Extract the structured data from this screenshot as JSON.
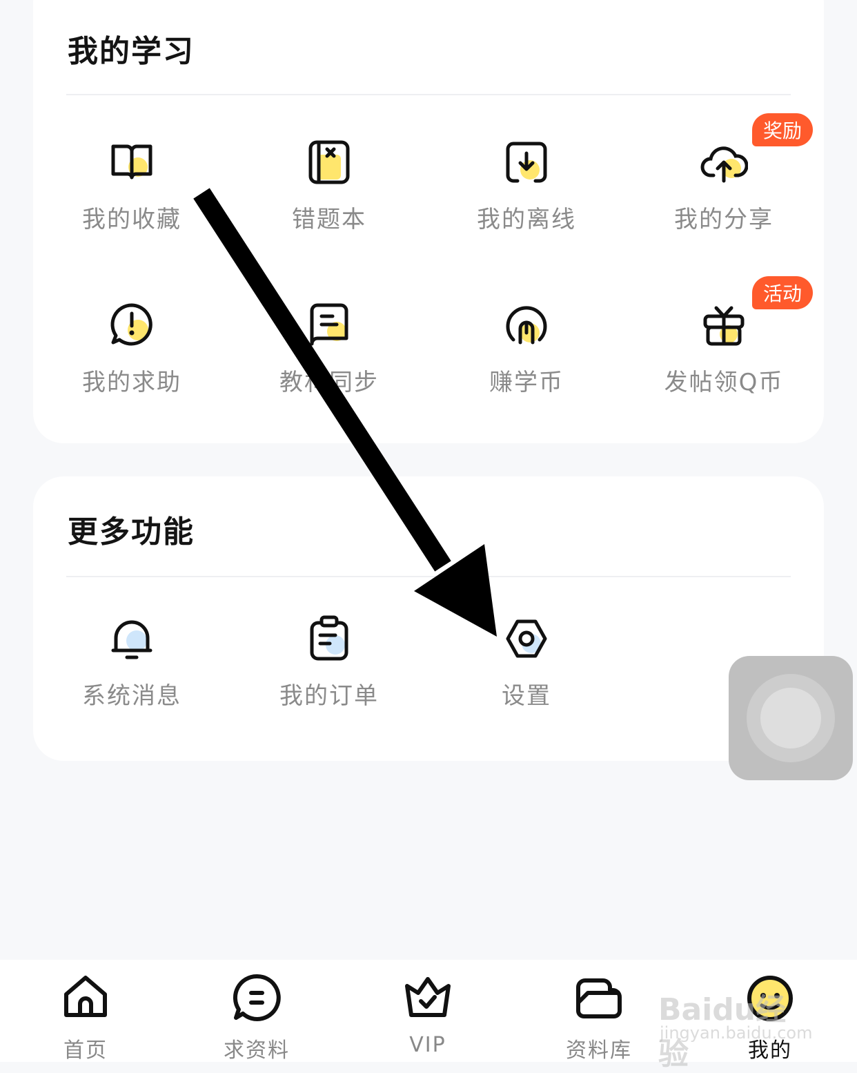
{
  "study": {
    "title": "我的学习",
    "items": [
      {
        "label": "我的收藏",
        "icon": "book-icon"
      },
      {
        "label": "错题本",
        "icon": "notebook-x-icon"
      },
      {
        "label": "我的离线",
        "icon": "download-box-icon"
      },
      {
        "label": "我的分享",
        "icon": "cloud-upload-icon",
        "badge": "奖励"
      },
      {
        "label": "我的求助",
        "icon": "exclamation-bubble-icon"
      },
      {
        "label": "教材同步",
        "icon": "textbook-icon"
      },
      {
        "label": "赚学币",
        "icon": "coin-icon"
      },
      {
        "label": "发帖领Q币",
        "icon": "gift-icon",
        "badge": "活动"
      }
    ]
  },
  "more": {
    "title": "更多功能",
    "items": [
      {
        "label": "系统消息",
        "icon": "bell-icon"
      },
      {
        "label": "我的订单",
        "icon": "clipboard-icon"
      },
      {
        "label": "设置",
        "icon": "gear-icon"
      }
    ]
  },
  "tabbar": {
    "items": [
      {
        "label": "首页",
        "icon": "home-icon"
      },
      {
        "label": "求资料",
        "icon": "chat-icon"
      },
      {
        "label": "VIP",
        "icon": "crown-icon"
      },
      {
        "label": "资料库",
        "icon": "folder-icon"
      },
      {
        "label": "我的",
        "icon": "profile-icon",
        "active": true
      }
    ]
  },
  "watermark": {
    "line1": "Baidu经验",
    "line2": "jingyan.baidu.com"
  },
  "colors": {
    "accent_yellow": "#ffe66d",
    "accent_blue": "#cfe6fb",
    "badge": "#ff5a2c",
    "label": "#8a8a8a"
  }
}
